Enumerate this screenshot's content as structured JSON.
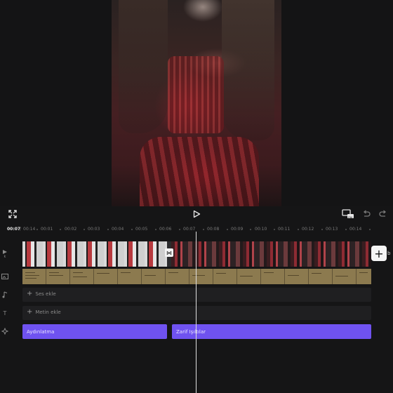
{
  "player": {
    "fullscreen_icon": "expand-icon",
    "play_icon": "play-icon",
    "preview_icon": "preview-screen-icon",
    "undo_icon": "undo-icon",
    "redo_icon": "redo-icon",
    "preview_badge": "ON"
  },
  "timeline": {
    "current_time": "00:07",
    "separator": "/",
    "total_time": "00:14",
    "ticks": [
      "00:01",
      "00:02",
      "00:03",
      "00:04",
      "00:05",
      "00:06",
      "00:07",
      "00:08",
      "00:09",
      "00:10",
      "00:11",
      "00:12",
      "00:13",
      "00:14"
    ]
  },
  "tools": [
    {
      "icon": "video-icon",
      "label": "k"
    },
    {
      "icon": "image-icon",
      "label": ""
    },
    {
      "icon": "music-note-icon",
      "label": ""
    },
    {
      "icon": "text-icon",
      "label": "T"
    },
    {
      "icon": "effects-icon",
      "label": ""
    }
  ],
  "tracks": {
    "audio_label": "Ses ekle",
    "text_label": "Metin ekle",
    "add_icon": "plus-icon",
    "add_clip_label": "+",
    "edge_label": "b",
    "transition_icon": "transition-icon",
    "effects": [
      {
        "label": "Aydınlatma"
      },
      {
        "label": "Zarif Işıltılar"
      }
    ]
  },
  "colors": {
    "background": "#151516",
    "effect_clip": "#6f52f0",
    "caption_track": "#8c7a4f",
    "playhead": "#e0e0e0"
  }
}
